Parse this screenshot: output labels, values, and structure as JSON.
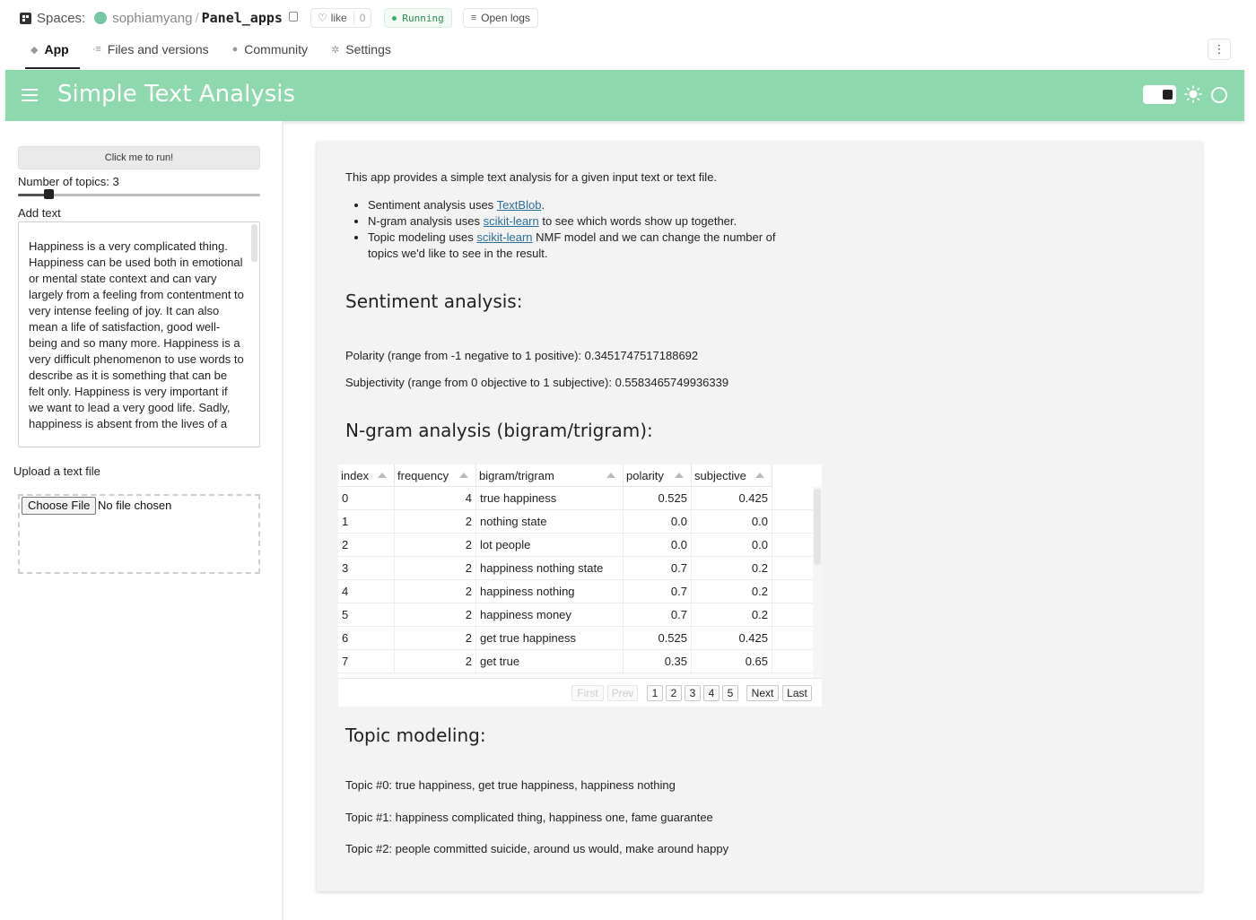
{
  "hf": {
    "spaces_label": "Spaces:",
    "owner": "sophiamyang",
    "separator": "/",
    "repo": "Panel_apps",
    "like_label": "like",
    "like_count": "0",
    "status": "Running",
    "open_logs": "Open logs",
    "tabs": [
      {
        "label": "App",
        "icon": "app-icon",
        "active": true
      },
      {
        "label": "Files and versions",
        "icon": "files-icon",
        "active": false
      },
      {
        "label": "Community",
        "icon": "community-icon",
        "active": false
      },
      {
        "label": "Settings",
        "icon": "settings-icon",
        "active": false
      }
    ],
    "menu_icon": "⋮"
  },
  "header": {
    "title": "Simple Text Analysis",
    "color": "#8dd9ad"
  },
  "sidebar": {
    "run_button": "Click me to run!",
    "topics_label": "Number of topics: 3",
    "topics_value": 3,
    "topics_min": 2,
    "topics_max": 10,
    "add_text_label": "Add text",
    "text_value": "Happiness is a very complicated thing. Happiness can be used both in emotional or mental state context and can vary largely from a feeling from contentment to very intense feeling of joy. It can also mean a life of satisfaction, good well-being and so many more. Happiness is a very difficult phenomenon to use words to describe as it is something that can be felt only. Happiness is very important if we want to lead a very good life. Sadly, happiness is absent from the lives of a",
    "upload_label": "Upload a text file",
    "choose_file": "Choose File",
    "no_file": "No file chosen"
  },
  "main": {
    "intro": "This app provides a simple text analysis for a given input text or text file.",
    "bullets": [
      {
        "pre": "Sentiment analysis uses ",
        "link": "TextBlob",
        "post": "."
      },
      {
        "pre": "N-gram analysis uses ",
        "link": "scikit-learn",
        "post": " to see which words show up together."
      },
      {
        "pre": "Topic modeling uses ",
        "link": "scikit-learn",
        "post": " NMF model and we can change the number of topics we'd like to see in the result."
      }
    ],
    "sentiment_heading": "Sentiment analysis:",
    "polarity": "Polarity (range from -1 negative to 1 positive): 0.3451747517188692",
    "subjectivity": "Subjectivity (range from 0 objective to 1 subjective): 0.5583465749936339",
    "ngram_heading": "N-gram analysis (bigram/trigram):",
    "table": {
      "columns": [
        "index",
        "frequency",
        "bigram/trigram",
        "polarity",
        "subjective"
      ],
      "rows": [
        [
          "0",
          "4",
          "true happiness",
          "0.525",
          "0.425"
        ],
        [
          "1",
          "2",
          "nothing state",
          "0.0",
          "0.0"
        ],
        [
          "2",
          "2",
          "lot people",
          "0.0",
          "0.0"
        ],
        [
          "3",
          "2",
          "happiness nothing state",
          "0.7",
          "0.2"
        ],
        [
          "4",
          "2",
          "happiness nothing",
          "0.7",
          "0.2"
        ],
        [
          "5",
          "2",
          "happiness money",
          "0.7",
          "0.2"
        ],
        [
          "6",
          "2",
          "get true happiness",
          "0.525",
          "0.425"
        ],
        [
          "7",
          "2",
          "get true",
          "0.35",
          "0.65"
        ]
      ],
      "pager": {
        "first": "First",
        "prev": "Prev",
        "pages": [
          "1",
          "2",
          "3",
          "4",
          "5"
        ],
        "next": "Next",
        "last": "Last"
      }
    },
    "topic_heading": "Topic modeling:",
    "topics": [
      "Topic #0: true happiness, get true happiness, happiness nothing",
      "Topic #1: happiness complicated thing, happiness one, fame guarantee",
      "Topic #2: people committed suicide, around us would, make around happy"
    ]
  }
}
